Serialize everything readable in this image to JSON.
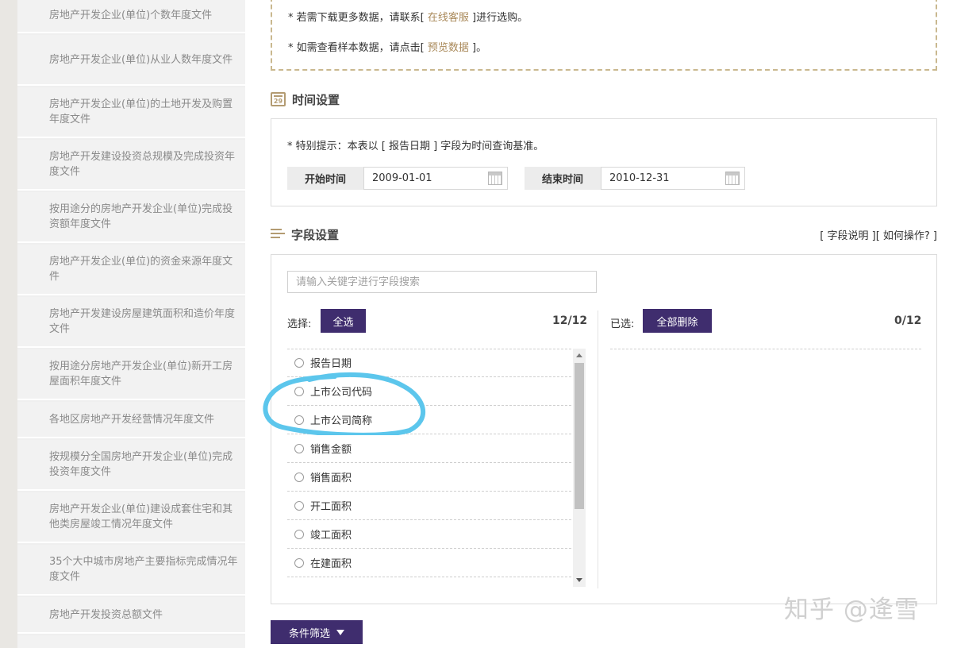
{
  "sidebar": {
    "items": [
      {
        "label": "房地产开发企业(单位)个数年度文件"
      },
      {
        "label": "房地产开发企业(单位)从业人数年度文件"
      },
      {
        "label": "房地产开发企业(单位)的土地开发及购置年度文件"
      },
      {
        "label": "房地产开发建设投资总规模及完成投资年度文件"
      },
      {
        "label": "按用途分的房地产开发企业(单位)完成投资额年度文件"
      },
      {
        "label": "房地产开发企业(单位)的资金来源年度文件"
      },
      {
        "label": "房地产开发建设房屋建筑面积和造价年度文件"
      },
      {
        "label": "按用途分房地产开发企业(单位)新开工房屋面积年度文件"
      },
      {
        "label": "各地区房地产开发经营情况年度文件"
      },
      {
        "label": "按规模分全国房地产开发企业(单位)完成投资年度文件"
      },
      {
        "label": "房地产开发企业(单位)建设成套住宅和其他类房屋竣工情况年度文件"
      },
      {
        "label": "35个大中城市房地产主要指标完成情况年度文件"
      },
      {
        "label": "房地产开发投资总额文件"
      }
    ]
  },
  "notice": {
    "line1_prefix": "* 若需下载更多数据，请联系[ ",
    "line1_link": "在线客服",
    "line1_suffix": " ]进行选购。",
    "line2_prefix": "* 如需查看样本数据，请点击[ ",
    "line2_link": "预览数据",
    "line2_suffix": " ]。"
  },
  "time_settings": {
    "title": "时间设置",
    "icon_day": "29",
    "tip": "* 特别提示：本表以 [ 报告日期 ] 字段为时间查询基准。",
    "start_label": "开始时间",
    "start_value": "2009-01-01",
    "end_label": "结束时间",
    "end_value": "2010-12-31"
  },
  "field_settings": {
    "title": "字段设置",
    "help_field": "[ 字段说明 ]",
    "help_how": "[ 如何操作? ]",
    "search_placeholder": "请输入关键字进行字段搜索",
    "select_label": "选择:",
    "select_all": "全选",
    "select_count": "12/12",
    "selected_label": "已选:",
    "delete_all": "全部删除",
    "selected_count": "0/12",
    "options": [
      {
        "label": "报告日期"
      },
      {
        "label": "上市公司代码"
      },
      {
        "label": "上市公司简称"
      },
      {
        "label": "销售金额"
      },
      {
        "label": "销售面积"
      },
      {
        "label": "开工面积"
      },
      {
        "label": "竣工面积"
      },
      {
        "label": "在建面积"
      }
    ]
  },
  "filter_button": "条件筛选",
  "watermark": "知乎 @逄雪",
  "colors": {
    "accent": "#3f2d6e",
    "link": "#a9895a",
    "highlight": "#5cc6ec"
  }
}
